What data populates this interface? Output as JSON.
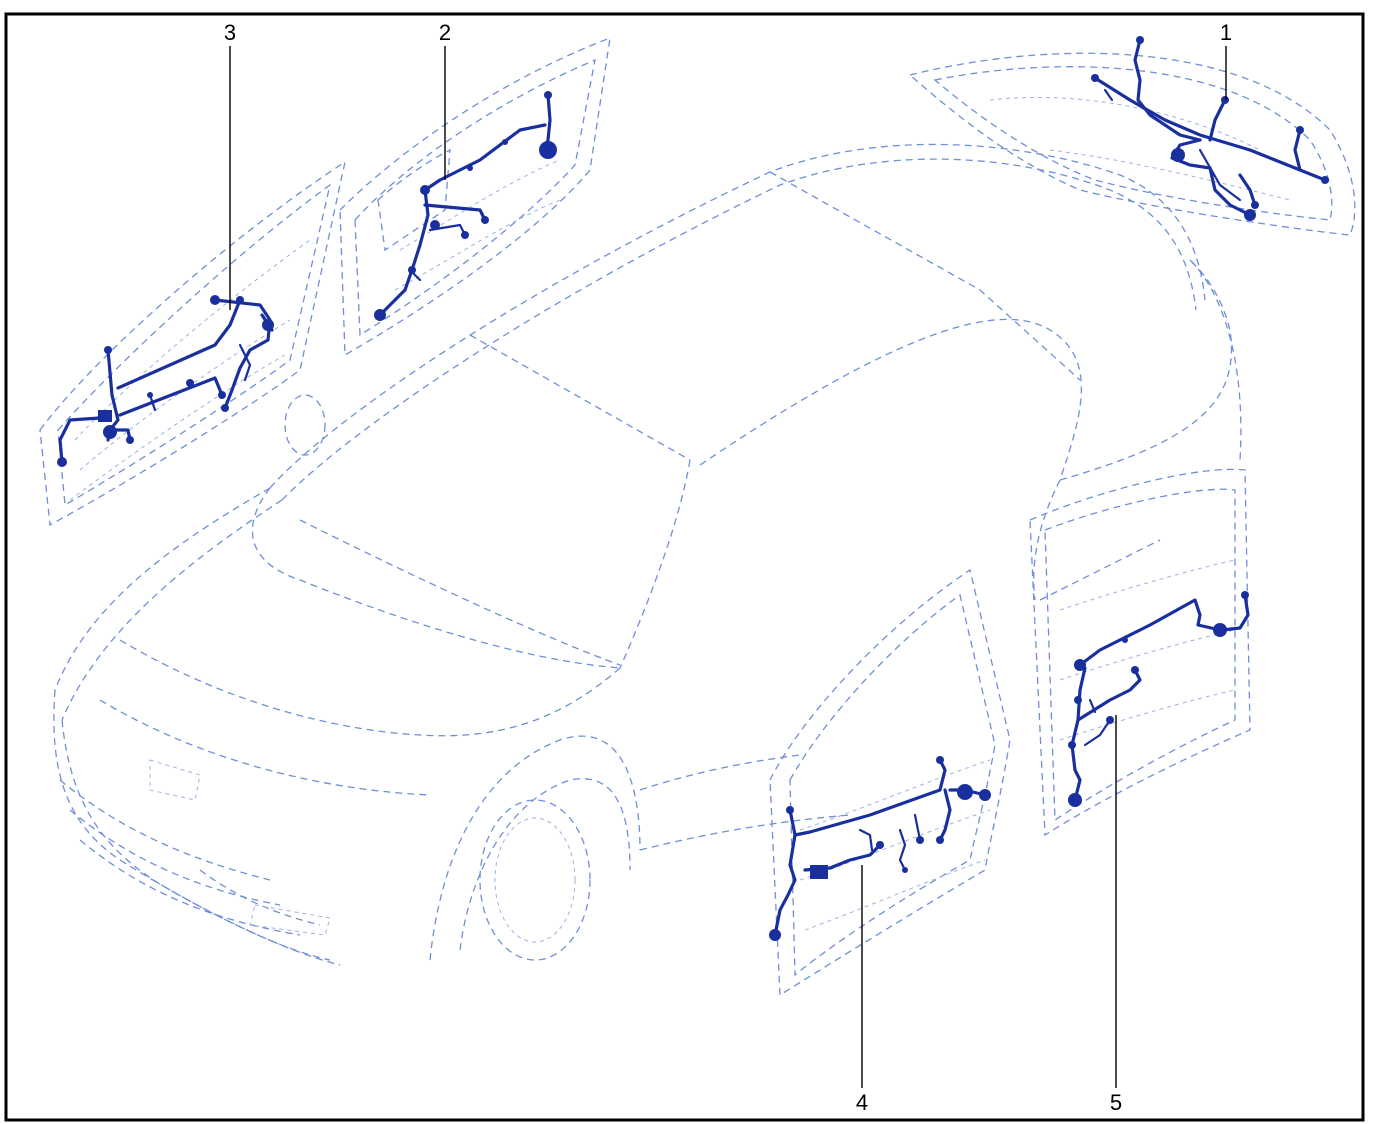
{
  "diagram": {
    "callouts": [
      {
        "id": "1",
        "label": "1"
      },
      {
        "id": "2",
        "label": "2"
      },
      {
        "id": "3",
        "label": "3"
      },
      {
        "id": "4",
        "label": "4"
      },
      {
        "id": "5",
        "label": "5"
      }
    ],
    "colors": {
      "ghost_outline": "#6f8fd6",
      "harness": "#1a2f9e",
      "border": "#000000",
      "callout_text": "#000000"
    }
  }
}
